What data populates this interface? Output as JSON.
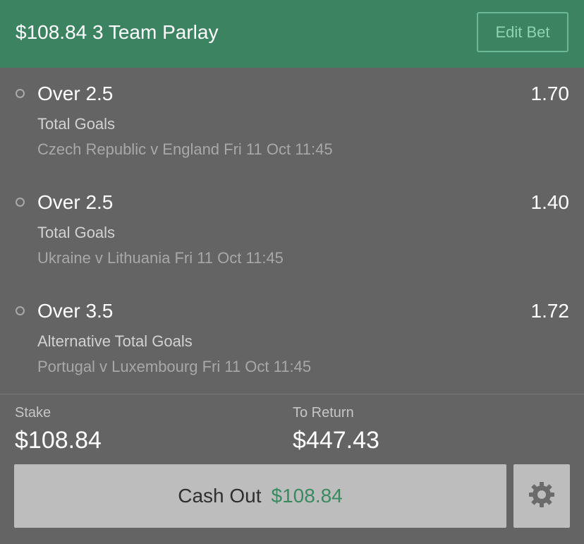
{
  "header": {
    "title": "$108.84 3 Team Parlay",
    "edit_label": "Edit Bet"
  },
  "selections": [
    {
      "name": "Over 2.5",
      "odds": "1.70",
      "market": "Total Goals",
      "event": "Czech Republic v England Fri 11 Oct 11:45"
    },
    {
      "name": "Over 2.5",
      "odds": "1.40",
      "market": "Total Goals",
      "event": "Ukraine v Lithuania Fri 11 Oct 11:45"
    },
    {
      "name": "Over 3.5",
      "odds": "1.72",
      "market": "Alternative Total Goals",
      "event": "Portugal v Luxembourg Fri 11 Oct 11:45"
    }
  ],
  "summary": {
    "stake_label": "Stake",
    "stake_value": "$108.84",
    "return_label": "To Return",
    "return_value": "$447.43"
  },
  "cashout": {
    "label": "Cash Out",
    "amount": "$108.84"
  },
  "icons": {
    "settings": "gear-icon",
    "selection_marker": "radio-circle-icon"
  },
  "colors": {
    "header_bg": "#3c8461",
    "accent_green": "#3a8a60",
    "panel_bg": "#646464"
  }
}
